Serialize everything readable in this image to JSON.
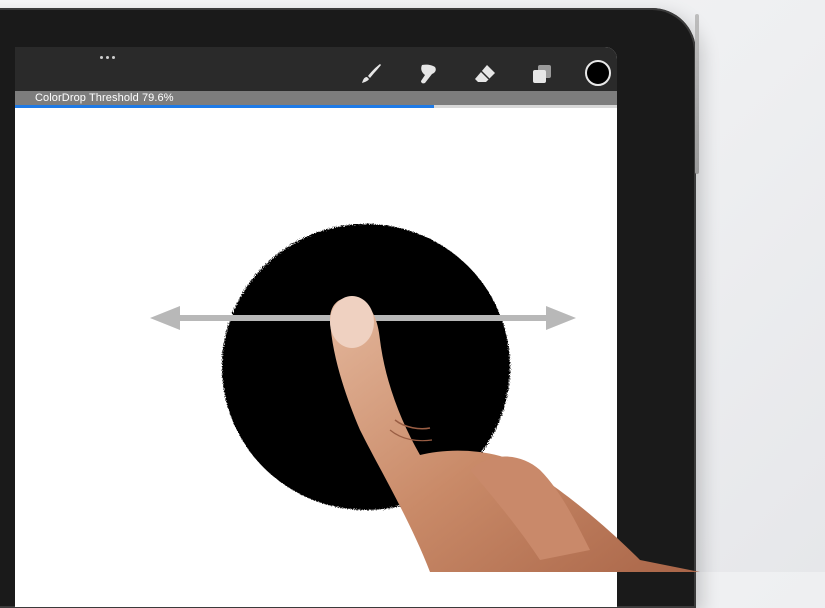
{
  "toolbar": {
    "more_icon": "ellipsis-icon",
    "tools": [
      {
        "name": "brush",
        "icon": "brush-icon"
      },
      {
        "name": "smudge",
        "icon": "smudge-icon"
      },
      {
        "name": "eraser",
        "icon": "eraser-icon"
      },
      {
        "name": "layers",
        "icon": "layers-icon"
      }
    ],
    "current_color": "#000000"
  },
  "status": {
    "label": "ColorDrop Threshold 79.6%",
    "threshold_fraction": 0.796,
    "accent_color": "#1e7ae6"
  },
  "canvas": {
    "shape": "circle",
    "fill_color": "#000000",
    "gesture": "horizontal-drag-arrows"
  }
}
